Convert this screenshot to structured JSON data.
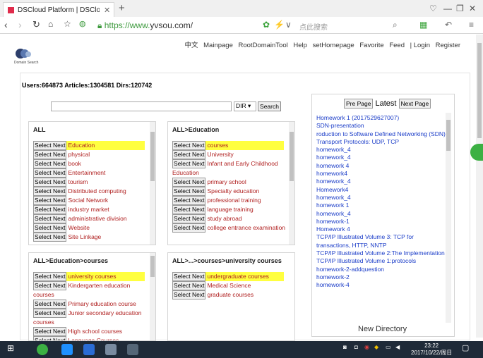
{
  "browser": {
    "tab_title": "DSCloud Platform | DSCloudl",
    "new_tab": "+",
    "url_prefix": "https://www.",
    "url_domain": "yvsou.com/",
    "search_placeholder": "点此搜索"
  },
  "topnav": {
    "items": [
      "中文",
      "Mainpage",
      "RootDomainTool",
      "Help",
      "setHomepage",
      "Favorite",
      "Feed",
      "| Login",
      "Register"
    ]
  },
  "logo": {
    "text": "Domain Search"
  },
  "stats": {
    "text": "Users:664873 Articles:1304581 Dirs:120742"
  },
  "search": {
    "dir_value": "DIR ▾",
    "button": "Search"
  },
  "select_next_label": "Select Next",
  "panels": {
    "all": {
      "title": "ALL",
      "items": [
        "Education",
        "physical",
        "book",
        "Entertainment",
        "tourism",
        "Distributed computing",
        "Social Network",
        "industry market",
        "administrative division",
        "Website",
        "Site Linkage"
      ]
    },
    "education": {
      "title": "ALL>Education",
      "items": [
        "courses",
        "University",
        "Infant and Early Childhood Education",
        "primary school",
        "Specialty education",
        "professional training",
        "language training",
        "study abroad",
        "college entrance examination"
      ]
    },
    "courses": {
      "title": "ALL>Education>courses",
      "items": [
        "university courses",
        "Kindergarten education courses",
        "Primary education course",
        "Junior secondary education courses",
        "High school courses",
        "Language Courses"
      ]
    },
    "univ": {
      "title": "ALL>...>courses>university courses",
      "items": [
        "undergraduate courses",
        "Medical Science",
        "graduate courses"
      ]
    }
  },
  "latest": {
    "pre_page": "Pre Page",
    "title": "Latest",
    "next_page": "Next Page",
    "items": [
      "Homework 1 (201752962700​7)",
      "SDN-presentation",
      "roduction to Software Defined Networking (SDN)",
      "Transport Protocols: UDP, TCP",
      "homework_4",
      "homework_4",
      "homework 4",
      "homework4",
      "homework_4",
      "Homework4",
      "homework_4",
      "homework 1",
      "homework_4",
      "homework-1",
      "Homework 4",
      "TCP/IP Illustrated Volume 3: TCP for transactions, HTTP, NNTP",
      "TCP/IP Illustrated Volume 2:The Implementation",
      "TCP/IP Illustrated Volume 1:protocols",
      "homework-2-addquestion",
      "homework-2",
      "homework-4"
    ],
    "new_directory": "New Directory"
  },
  "taskbar": {
    "time": "23:22",
    "date": "2017/10/22/周日"
  }
}
